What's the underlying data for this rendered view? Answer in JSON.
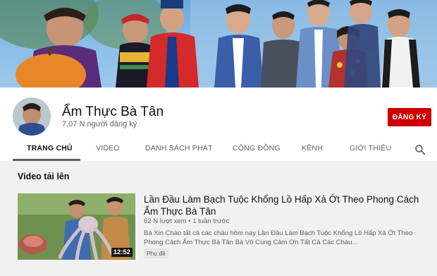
{
  "channel": {
    "name": "Ẩm Thực Bà Tân",
    "subscribers": "7,07 N người đăng ký",
    "subscribe_label": "ĐĂNG KÝ"
  },
  "tabs": [
    "TRANG CHỦ",
    "VIDEO",
    "DANH SÁCH PHÁT",
    "CỘNG ĐỒNG",
    "KÊNH",
    "GIỚI THIỆU"
  ],
  "active_tab": "TRANG CHỦ",
  "section": {
    "title": "Video tải lên"
  },
  "video": {
    "title": "Lần Đầu Làm Bạch Tuộc Khổng Lồ Hấp Xả Ớt Theo Phong Cách Ẩm Thực Bà Tân",
    "views": "62 N lượt xem",
    "separator": "•",
    "age": "1 tuần trước",
    "description": "Bà Xin Chào tất cả các cháu hôm nay Lần Đầu Làm Bạch Tuộc Khổng Lồ Hấp Xả Ớt Theo Phong Cách Ẩm Thực Bà Tân Bà Vô Cùng Cảm Ơn Tất Cả Các Cháu...",
    "duration": "12:52",
    "badge": "Phụ đề"
  },
  "colors": {
    "subscribe": "#cc0000",
    "tab_active": "#0f0f0f",
    "tab_inactive": "#606060",
    "background": "#f1f1f1"
  },
  "icons": {
    "search": "search-icon"
  }
}
